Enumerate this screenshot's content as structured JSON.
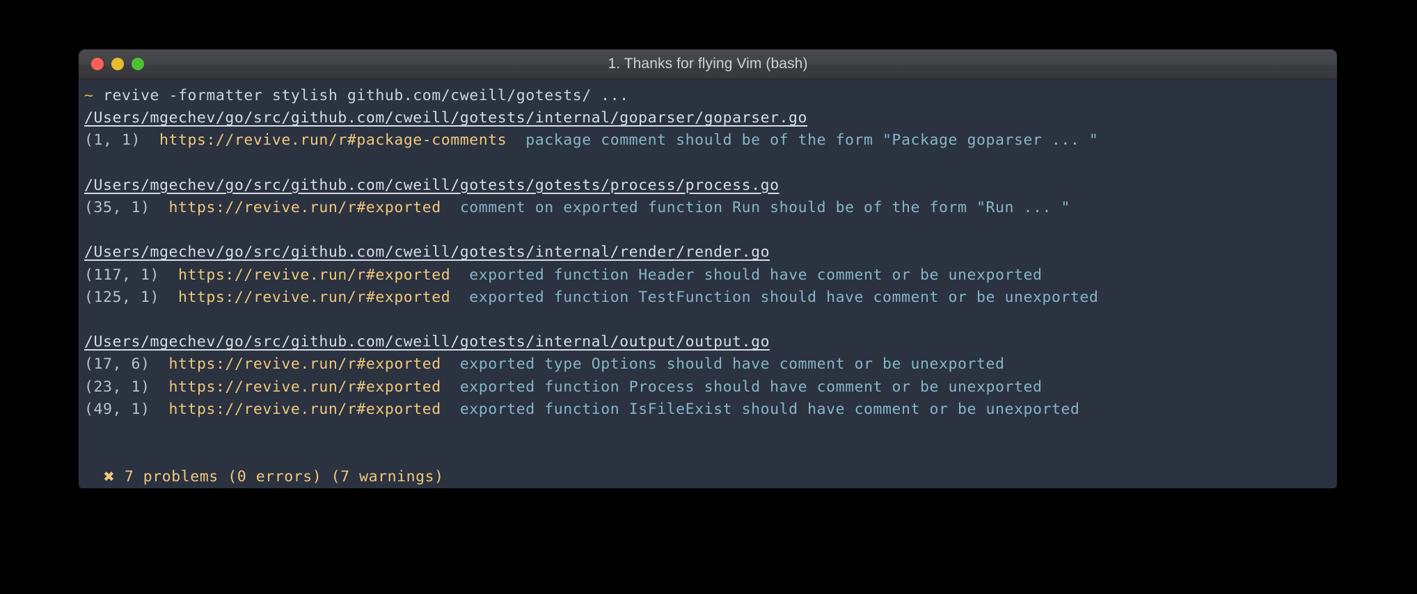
{
  "window": {
    "title": "1. Thanks for flying Vim (bash)",
    "traffic_lights": [
      {
        "name": "close",
        "color": "#ff5f57"
      },
      {
        "name": "minimize",
        "color": "#e6bc2f"
      },
      {
        "name": "zoom",
        "color": "#4cc136"
      }
    ]
  },
  "terminal": {
    "background": "#2b3240",
    "prompt_symbol": "~",
    "command": "revive -formatter stylish github.com/cweill/gotests/ ...",
    "groups": [
      {
        "file": "/Users/mgechev/go/src/github.com/cweill/gotests/internal/goparser/goparser.go",
        "issues": [
          {
            "position": "(1, 1)",
            "url": "https://revive.run/r#package-comments",
            "message": "package comment should be of the form \"Package goparser ... \""
          }
        ]
      },
      {
        "file": "/Users/mgechev/go/src/github.com/cweill/gotests/gotests/process/process.go",
        "issues": [
          {
            "position": "(35, 1)",
            "url": "https://revive.run/r#exported",
            "message": "comment on exported function Run should be of the form \"Run ... \""
          }
        ]
      },
      {
        "file": "/Users/mgechev/go/src/github.com/cweill/gotests/internal/render/render.go",
        "issues": [
          {
            "position": "(117, 1)",
            "url": "https://revive.run/r#exported",
            "message": "exported function Header should have comment or be unexported"
          },
          {
            "position": "(125, 1)",
            "url": "https://revive.run/r#exported",
            "message": "exported function TestFunction should have comment or be unexported"
          }
        ]
      },
      {
        "file": "/Users/mgechev/go/src/github.com/cweill/gotests/internal/output/output.go",
        "issues": [
          {
            "position": "(17, 6)",
            "url": "https://revive.run/r#exported",
            "message": "exported type Options should have comment or be unexported"
          },
          {
            "position": "(23, 1)",
            "url": "https://revive.run/r#exported",
            "message": "exported function Process should have comment or be unexported"
          },
          {
            "position": "(49, 1)",
            "url": "https://revive.run/r#exported",
            "message": "exported function IsFileExist should have comment or be unexported"
          }
        ]
      }
    ],
    "summary": {
      "mark": "✖",
      "text": "7 problems (0 errors) (7 warnings)",
      "color": "#efc87c"
    }
  },
  "colors": {
    "prompt": "#e3b341",
    "command": "#ccd4df",
    "file_path": "#d6dde6",
    "position": "#b9c2cd",
    "url": "#efc87c",
    "message": "#85b6c8",
    "terminal_bg": "#2b3240",
    "titlebar_bg": "#414346",
    "desktop_bg": "#000000"
  }
}
